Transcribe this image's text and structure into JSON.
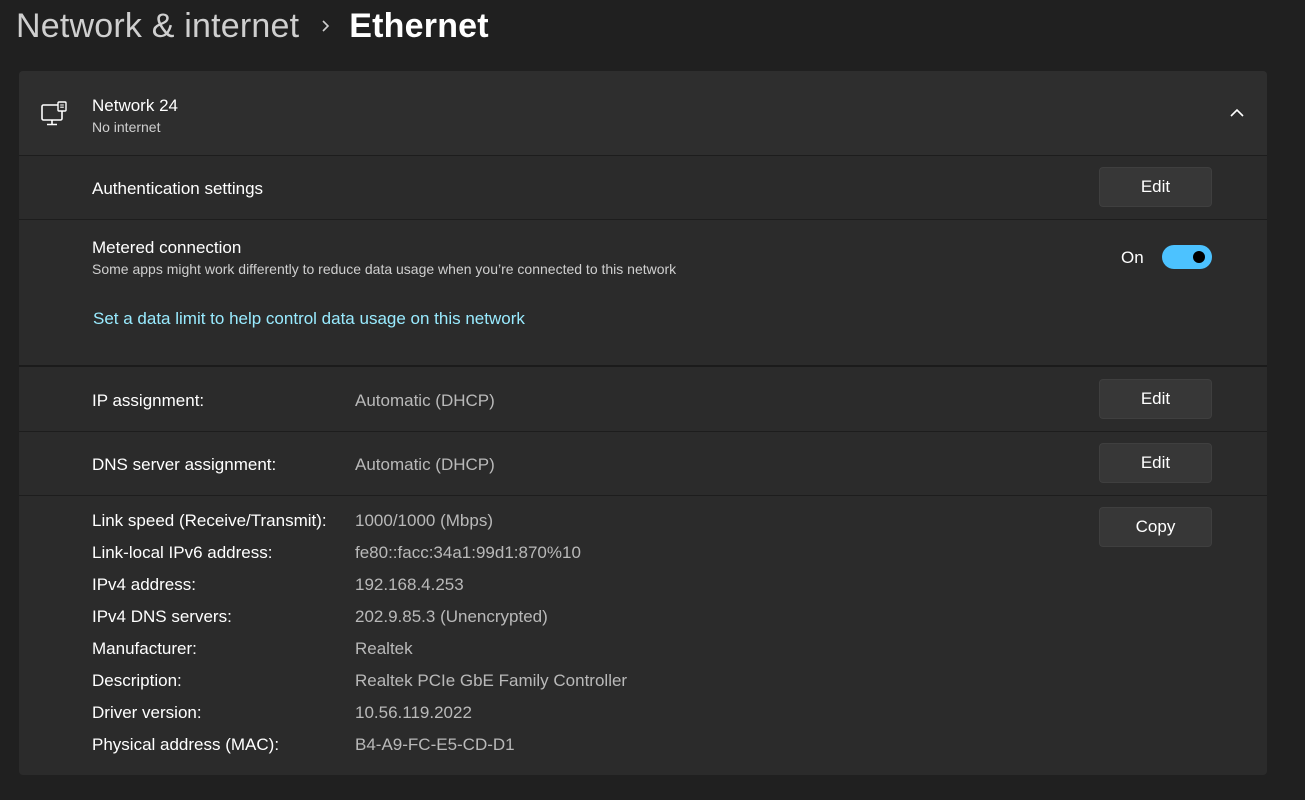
{
  "breadcrumb": {
    "parent": "Network & internet",
    "current": "Ethernet"
  },
  "network": {
    "name": "Network 24",
    "status": "No internet",
    "icon": "ethernet-monitor-icon"
  },
  "authentication": {
    "label": "Authentication settings",
    "button": "Edit"
  },
  "metered": {
    "label": "Metered connection",
    "description": "Some apps might work differently to reduce data usage when you’re connected to this network",
    "toggle_text": "On",
    "toggle_on": true,
    "link": "Set a data limit to help control data usage on this network"
  },
  "ip_assignment": {
    "label": "IP assignment:",
    "value": "Automatic (DHCP)",
    "button": "Edit"
  },
  "dns_assignment": {
    "label": "DNS server assignment:",
    "value": "Automatic (DHCP)",
    "button": "Edit"
  },
  "properties": {
    "copy_button": "Copy",
    "items": [
      {
        "label": "Link speed (Receive/Transmit):",
        "value": "1000/1000 (Mbps)"
      },
      {
        "label": "Link-local IPv6 address:",
        "value": "fe80::facc:34a1:99d1:870%10"
      },
      {
        "label": "IPv4 address:",
        "value": "192.168.4.253"
      },
      {
        "label": "IPv4 DNS servers:",
        "value": "202.9.85.3 (Unencrypted)"
      },
      {
        "label": "Manufacturer:",
        "value": "Realtek"
      },
      {
        "label": "Description:",
        "value": "Realtek PCIe GbE Family Controller"
      },
      {
        "label": "Driver version:",
        "value": "10.56.119.2022"
      },
      {
        "label": "Physical address (MAC):",
        "value": "B4-A9-FC-E5-CD-D1"
      }
    ]
  },
  "colors": {
    "accent": "#4cc2ff",
    "link": "#99ebff",
    "background": "#202020",
    "card": "#2b2b2b"
  }
}
